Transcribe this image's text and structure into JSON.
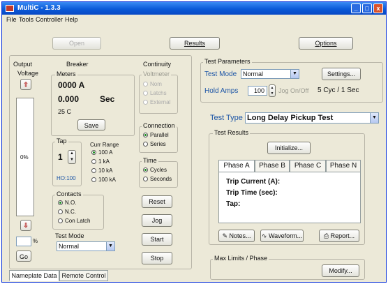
{
  "window": {
    "title": "MultiC - 1.3.3",
    "min": "_",
    "max": "□",
    "close": "x"
  },
  "menu": [
    "File",
    "Tools",
    "Controller",
    "Help"
  ],
  "toolbar": {
    "open": "Open",
    "results": "Results",
    "options": "Options"
  },
  "output": {
    "label": "Output",
    "voltage_label": "Voltage",
    "percent": "0%",
    "unit": "%",
    "go": "Go"
  },
  "breaker": {
    "label": "Breaker",
    "meters_label": "Meters",
    "current": "0000 A",
    "time_value": "0.000",
    "time_unit": "Sec",
    "temp": "25 C",
    "save": "Save",
    "tap_label": "Tap",
    "tap_value": "1",
    "tap_sub": "HO:100",
    "cur_range_label": "Curr Range",
    "cur_ranges": [
      "100 A",
      "1 kA",
      "10 kA",
      "100 kA"
    ],
    "cur_range_selected": 0,
    "contacts_label": "Contacts",
    "contacts": [
      "N.O.",
      "N.C.",
      "Con Latch"
    ],
    "contacts_selected": 0,
    "test_mode_label": "Test Mode",
    "test_mode_value": "Normal"
  },
  "continuity": {
    "label": "Continuity",
    "voltmeter_label": "Voltmeter",
    "voltmeter": [
      "Nom",
      "Latchs",
      "External"
    ],
    "connection_label": "Connection",
    "connection": [
      "Parallel",
      "Series"
    ],
    "connection_selected": 0,
    "time_label": "Time",
    "time": [
      "Cycles",
      "Seconds"
    ],
    "time_selected": 0,
    "buttons": [
      "Reset",
      "Jog",
      "Start",
      "Stop"
    ]
  },
  "test_params": {
    "label": "Test Parameters",
    "mode_label": "Test Mode",
    "mode_value": "Normal",
    "settings": "Settings...",
    "hold_label": "Hold Amps",
    "hold_value": "100",
    "jog_label": "Jog On/Off",
    "jog_value": "5 Cyc / 1 Sec"
  },
  "test_type": {
    "label": "Test Type",
    "value": "Long Delay Pickup Test"
  },
  "results": {
    "label": "Test Results",
    "initialize": "Initialize...",
    "tabs": [
      "Phase A",
      "Phase B",
      "Phase C",
      "Phase N"
    ],
    "trip_current": "Trip Current (A):",
    "trip_time": "Trip Time (sec):",
    "tap": "Tap:",
    "notes": "Notes...",
    "waveform": "Waveform...",
    "report": "Report..."
  },
  "max_limits": {
    "label": "Max Limits / Phase",
    "modify": "Modify..."
  },
  "bottom_tabs": [
    "Nameplate Data",
    "Remote Control"
  ]
}
